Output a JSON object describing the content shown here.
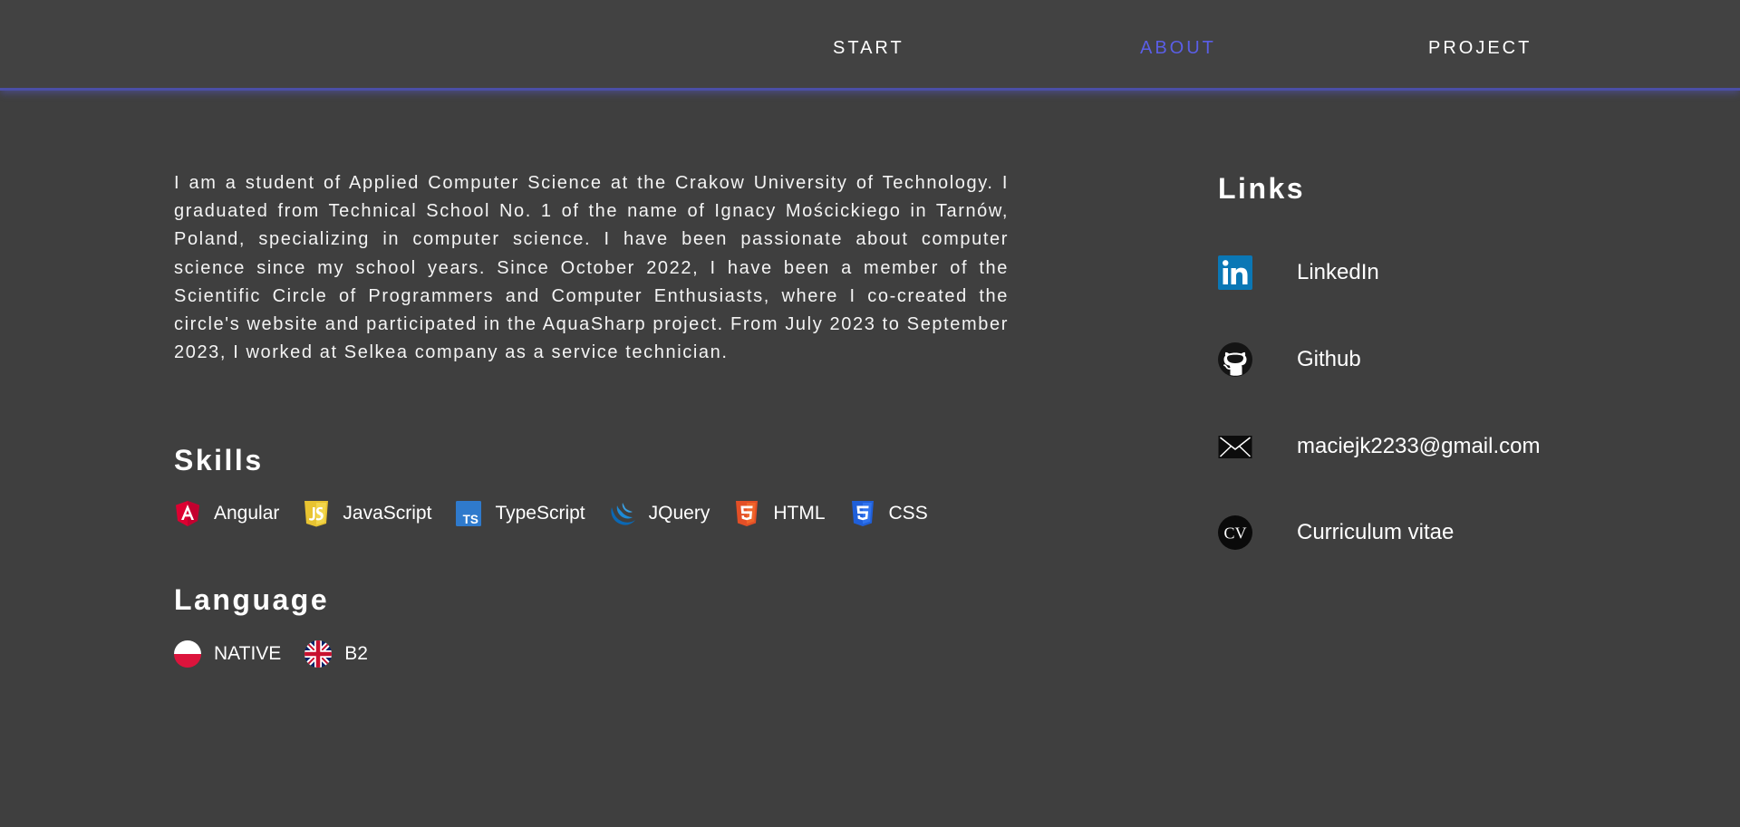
{
  "nav": {
    "items": [
      {
        "label": "START",
        "active": false
      },
      {
        "label": "ABOUT",
        "active": true
      },
      {
        "label": "PROJECT",
        "active": false
      }
    ],
    "active_color": "#5a5ee6"
  },
  "about": {
    "text": "I am a student of Applied Computer Science at the Crakow University of Technology. I graduated from Technical School No. 1 of the name of Ignacy Mościckiego in Tarnów, Poland, specializing in computer science. I have been passionate about computer science since my school years. Since October 2022, I have been a member of the Scientific Circle of Programmers and Computer Enthusiasts, where I co-created the circle's website and participated in the AquaSharp project. From July 2023 to September 2023, I worked at Selkea company as a service technician."
  },
  "skills": {
    "title": "Skills",
    "items": [
      {
        "label": "Angular",
        "icon": "angular-icon"
      },
      {
        "label": "JavaScript",
        "icon": "javascript-icon"
      },
      {
        "label": "TypeScript",
        "icon": "typescript-icon"
      },
      {
        "label": "JQuery",
        "icon": "jquery-icon"
      },
      {
        "label": "HTML",
        "icon": "html5-icon"
      },
      {
        "label": "CSS",
        "icon": "css3-icon"
      }
    ]
  },
  "language": {
    "title": "Language",
    "items": [
      {
        "label": "NATIVE",
        "icon": "poland-flag-icon"
      },
      {
        "label": "B2",
        "icon": "uk-flag-icon"
      }
    ]
  },
  "links": {
    "title": "Links",
    "items": [
      {
        "label": "LinkedIn",
        "icon": "linkedin-icon"
      },
      {
        "label": "Github",
        "icon": "github-icon"
      },
      {
        "label": "maciejk2233@gmail.com",
        "icon": "mail-icon"
      },
      {
        "label": "Curriculum vitae",
        "icon": "cv-icon"
      }
    ]
  },
  "colors": {
    "background": "#3f3f3f",
    "header_border": "#4b4fa6",
    "accent": "#5a5ee6"
  }
}
